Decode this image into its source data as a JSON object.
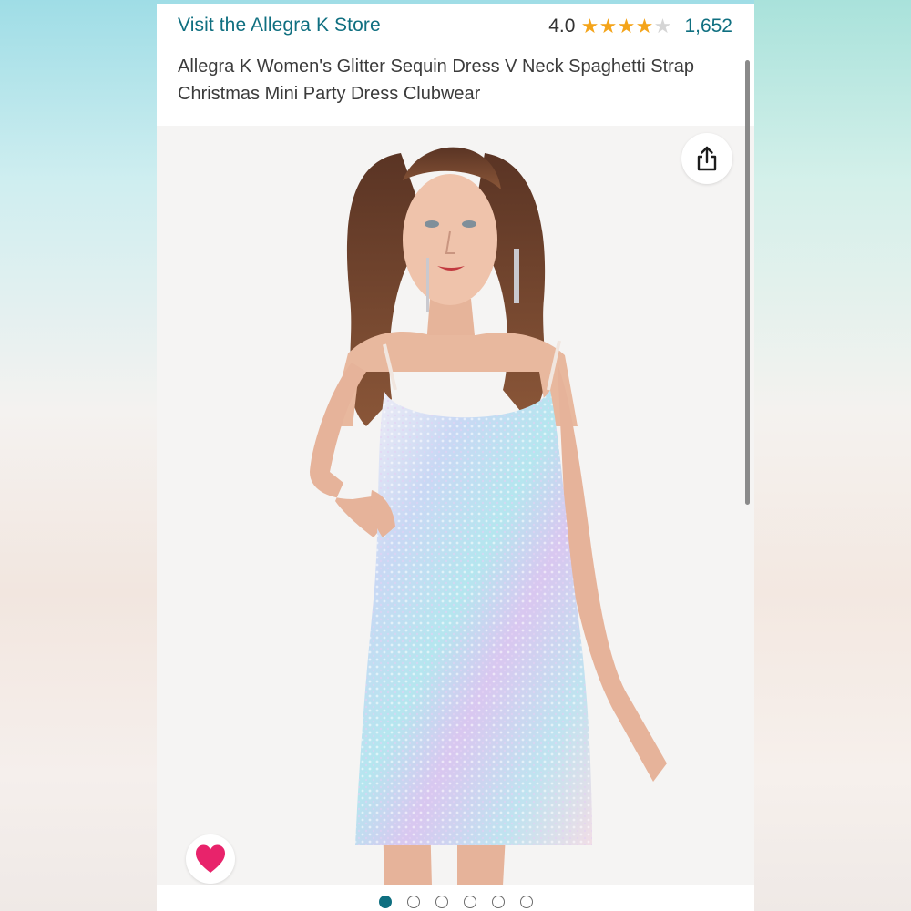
{
  "header": {
    "store_link": "Visit the Allegra K Store",
    "rating_value": "4.0",
    "rating": 4.0,
    "rating_max": 5,
    "review_count": "1,652",
    "product_title": "Allegra K Women's Glitter Sequin Dress V Neck Spaghetti Strap Christmas Mini Party Dress Clubwear"
  },
  "gallery": {
    "image_count": 6,
    "active_index": 0
  },
  "icons": {
    "share": "share-icon",
    "favorite": "heart-icon"
  },
  "colors": {
    "link": "#0f6f80",
    "star": "#f4a41a",
    "heart": "#e8236b"
  }
}
